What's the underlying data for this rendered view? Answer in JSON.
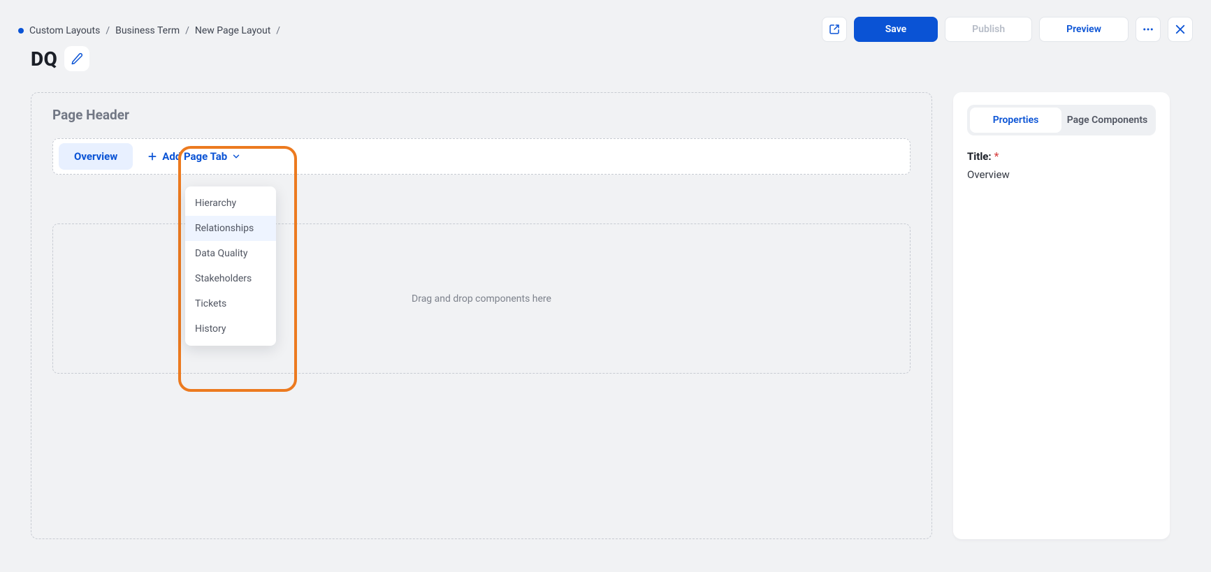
{
  "breadcrumbs": [
    "Custom Layouts",
    "Business Term",
    "New Page Layout"
  ],
  "actions": {
    "save": "Save",
    "publish": "Publish",
    "preview": "Preview"
  },
  "page_title": "DQ",
  "canvas": {
    "header_label": "Page Header",
    "tabs": [
      {
        "label": "Overview",
        "active": true
      }
    ],
    "add_tab_label": "Add Page Tab",
    "dropzone_hint": "Drag and drop components here"
  },
  "add_tab_menu": [
    "Hierarchy",
    "Relationships",
    "Data Quality",
    "Stakeholders",
    "Tickets",
    "History"
  ],
  "panel": {
    "segments": [
      "Properties",
      "Page Components"
    ],
    "active_segment": 0,
    "field_label": "Title:",
    "field_value": "Overview"
  }
}
